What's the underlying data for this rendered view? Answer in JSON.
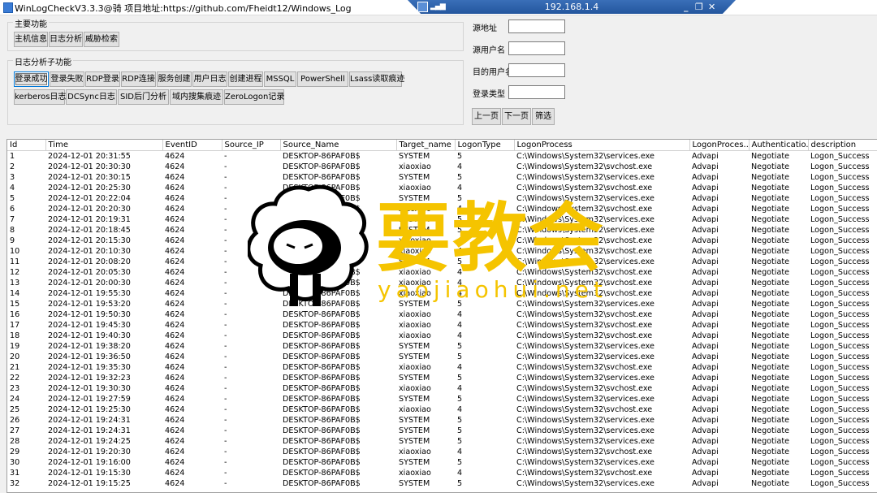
{
  "window": {
    "title": "WinLogCheckV3.3.3@骑 项目地址:https://github.com/Fheidt12/Windows_Log"
  },
  "rdp": {
    "ip": "192.168.1.4",
    "signal_icon": "signal-bars-icon",
    "pin_icon": "pin-icon",
    "minimize": "_",
    "restore": "❐",
    "close": "✕"
  },
  "main_functions": {
    "legend": "主要功能",
    "buttons": [
      "主机信息",
      "日志分析",
      "威胁检索"
    ]
  },
  "sub_functions": {
    "legend": "日志分析子功能",
    "row1": [
      "登录成功",
      "登录失败",
      "RDP登录",
      "RDP连接",
      "服务创建",
      "用户日志",
      "创建进程",
      "MSSQL",
      "PowerShell",
      "Lsass读取痕迹"
    ],
    "row2": [
      "kerberos日志",
      "DCSync日志",
      "SID后门分析",
      "域内搜集痕迹",
      "ZeroLogon记录"
    ]
  },
  "filters": {
    "source_addr_label": "源地址",
    "source_user_label": "源用户名",
    "target_user_label": "目的用户名",
    "logon_type_label": "登录类型",
    "source_addr_value": "",
    "source_user_value": "",
    "target_user_value": "",
    "logon_type_value": "",
    "prev_label": "上一页",
    "next_label": "下一页",
    "filter_label": "筛选"
  },
  "table": {
    "columns": [
      "Id",
      "Time",
      "EventID",
      "Source_IP",
      "Source_Name",
      "Target_name",
      "LogonType",
      "LogonProcess",
      "LogonProces...",
      "Authenticatio...",
      "description"
    ],
    "rows": [
      [
        "1",
        "2024-12-01 20:31:55",
        "4624",
        "-",
        "DESKTOP-86PAF0B$",
        "SYSTEM",
        "5",
        "C:\\Windows\\System32\\services.exe",
        "Advapi",
        "Negotiate",
        "Logon_Success"
      ],
      [
        "2",
        "2024-12-01 20:30:30",
        "4624",
        "-",
        "DESKTOP-86PAF0B$",
        "xiaoxiao",
        "4",
        "C:\\Windows\\System32\\svchost.exe",
        "Advapi",
        "Negotiate",
        "Logon_Success"
      ],
      [
        "3",
        "2024-12-01 20:30:15",
        "4624",
        "-",
        "DESKTOP-86PAF0B$",
        "SYSTEM",
        "5",
        "C:\\Windows\\System32\\services.exe",
        "Advapi",
        "Negotiate",
        "Logon_Success"
      ],
      [
        "4",
        "2024-12-01 20:25:30",
        "4624",
        "-",
        "DESKTOP-86PAF0B$",
        "xiaoxiao",
        "4",
        "C:\\Windows\\System32\\svchost.exe",
        "Advapi",
        "Negotiate",
        "Logon_Success"
      ],
      [
        "5",
        "2024-12-01 20:22:04",
        "4624",
        "-",
        "DESKTOP-86PAF0B$",
        "SYSTEM",
        "5",
        "C:\\Windows\\System32\\services.exe",
        "Advapi",
        "Negotiate",
        "Logon_Success"
      ],
      [
        "6",
        "2024-12-01 20:20:30",
        "4624",
        "-",
        "DESKTOP-86PAF0B$",
        "xiaoxiao",
        "4",
        "C:\\Windows\\System32\\svchost.exe",
        "Advapi",
        "Negotiate",
        "Logon_Success"
      ],
      [
        "7",
        "2024-12-01 20:19:31",
        "4624",
        "-",
        "DESKTOP-86PAF0B$",
        "SYSTEM",
        "5",
        "C:\\Windows\\System32\\services.exe",
        "Advapi",
        "Negotiate",
        "Logon_Success"
      ],
      [
        "8",
        "2024-12-01 20:18:45",
        "4624",
        "-",
        "DESKTOP-86PAF0B$",
        "SYSTEM",
        "5",
        "C:\\Windows\\System32\\services.exe",
        "Advapi",
        "Negotiate",
        "Logon_Success"
      ],
      [
        "9",
        "2024-12-01 20:15:30",
        "4624",
        "-",
        "DESKTOP-86PAF0B$",
        "xiaoxiao",
        "4",
        "C:\\Windows\\System32\\svchost.exe",
        "Advapi",
        "Negotiate",
        "Logon_Success"
      ],
      [
        "10",
        "2024-12-01 20:10:30",
        "4624",
        "-",
        "DESKTOP-86PAF0B$",
        "xiaoxiao",
        "4",
        "C:\\Windows\\System32\\svchost.exe",
        "Advapi",
        "Negotiate",
        "Logon_Success"
      ],
      [
        "11",
        "2024-12-01 20:08:20",
        "4624",
        "-",
        "DESKTOP-86PAF0B$",
        "SYSTEM",
        "5",
        "C:\\Windows\\System32\\services.exe",
        "Advapi",
        "Negotiate",
        "Logon_Success"
      ],
      [
        "12",
        "2024-12-01 20:05:30",
        "4624",
        "-",
        "DESKTOP-86PAF0B$",
        "xiaoxiao",
        "4",
        "C:\\Windows\\System32\\svchost.exe",
        "Advapi",
        "Negotiate",
        "Logon_Success"
      ],
      [
        "13",
        "2024-12-01 20:00:30",
        "4624",
        "-",
        "DESKTOP-86PAF0B$",
        "xiaoxiao",
        "4",
        "C:\\Windows\\System32\\svchost.exe",
        "Advapi",
        "Negotiate",
        "Logon_Success"
      ],
      [
        "14",
        "2024-12-01 19:55:30",
        "4624",
        "-",
        "DESKTOP-86PAF0B$",
        "xiaoxiao",
        "4",
        "C:\\Windows\\System32\\svchost.exe",
        "Advapi",
        "Negotiate",
        "Logon_Success"
      ],
      [
        "15",
        "2024-12-01 19:53:20",
        "4624",
        "-",
        "DESKTOP-86PAF0B$",
        "SYSTEM",
        "5",
        "C:\\Windows\\System32\\services.exe",
        "Advapi",
        "Negotiate",
        "Logon_Success"
      ],
      [
        "16",
        "2024-12-01 19:50:30",
        "4624",
        "-",
        "DESKTOP-86PAF0B$",
        "xiaoxiao",
        "4",
        "C:\\Windows\\System32\\svchost.exe",
        "Advapi",
        "Negotiate",
        "Logon_Success"
      ],
      [
        "17",
        "2024-12-01 19:45:30",
        "4624",
        "-",
        "DESKTOP-86PAF0B$",
        "xiaoxiao",
        "4",
        "C:\\Windows\\System32\\svchost.exe",
        "Advapi",
        "Negotiate",
        "Logon_Success"
      ],
      [
        "18",
        "2024-12-01 19:40:30",
        "4624",
        "-",
        "DESKTOP-86PAF0B$",
        "xiaoxiao",
        "4",
        "C:\\Windows\\System32\\svchost.exe",
        "Advapi",
        "Negotiate",
        "Logon_Success"
      ],
      [
        "19",
        "2024-12-01 19:38:20",
        "4624",
        "-",
        "DESKTOP-86PAF0B$",
        "SYSTEM",
        "5",
        "C:\\Windows\\System32\\services.exe",
        "Advapi",
        "Negotiate",
        "Logon_Success"
      ],
      [
        "20",
        "2024-12-01 19:36:50",
        "4624",
        "-",
        "DESKTOP-86PAF0B$",
        "SYSTEM",
        "5",
        "C:\\Windows\\System32\\services.exe",
        "Advapi",
        "Negotiate",
        "Logon_Success"
      ],
      [
        "21",
        "2024-12-01 19:35:30",
        "4624",
        "-",
        "DESKTOP-86PAF0B$",
        "xiaoxiao",
        "4",
        "C:\\Windows\\System32\\svchost.exe",
        "Advapi",
        "Negotiate",
        "Logon_Success"
      ],
      [
        "22",
        "2024-12-01 19:32:23",
        "4624",
        "-",
        "DESKTOP-86PAF0B$",
        "SYSTEM",
        "5",
        "C:\\Windows\\System32\\services.exe",
        "Advapi",
        "Negotiate",
        "Logon_Success"
      ],
      [
        "23",
        "2024-12-01 19:30:30",
        "4624",
        "-",
        "DESKTOP-86PAF0B$",
        "xiaoxiao",
        "4",
        "C:\\Windows\\System32\\svchost.exe",
        "Advapi",
        "Negotiate",
        "Logon_Success"
      ],
      [
        "24",
        "2024-12-01 19:27:59",
        "4624",
        "-",
        "DESKTOP-86PAF0B$",
        "SYSTEM",
        "5",
        "C:\\Windows\\System32\\services.exe",
        "Advapi",
        "Negotiate",
        "Logon_Success"
      ],
      [
        "25",
        "2024-12-01 19:25:30",
        "4624",
        "-",
        "DESKTOP-86PAF0B$",
        "xiaoxiao",
        "4",
        "C:\\Windows\\System32\\svchost.exe",
        "Advapi",
        "Negotiate",
        "Logon_Success"
      ],
      [
        "26",
        "2024-12-01 19:24:31",
        "4624",
        "-",
        "DESKTOP-86PAF0B$",
        "SYSTEM",
        "5",
        "C:\\Windows\\System32\\services.exe",
        "Advapi",
        "Negotiate",
        "Logon_Success"
      ],
      [
        "27",
        "2024-12-01 19:24:31",
        "4624",
        "-",
        "DESKTOP-86PAF0B$",
        "SYSTEM",
        "5",
        "C:\\Windows\\System32\\services.exe",
        "Advapi",
        "Negotiate",
        "Logon_Success"
      ],
      [
        "28",
        "2024-12-01 19:24:25",
        "4624",
        "-",
        "DESKTOP-86PAF0B$",
        "SYSTEM",
        "5",
        "C:\\Windows\\System32\\services.exe",
        "Advapi",
        "Negotiate",
        "Logon_Success"
      ],
      [
        "29",
        "2024-12-01 19:20:30",
        "4624",
        "-",
        "DESKTOP-86PAF0B$",
        "xiaoxiao",
        "4",
        "C:\\Windows\\System32\\svchost.exe",
        "Advapi",
        "Negotiate",
        "Logon_Success"
      ],
      [
        "30",
        "2024-12-01 19:16:00",
        "4624",
        "-",
        "DESKTOP-86PAF0B$",
        "SYSTEM",
        "5",
        "C:\\Windows\\System32\\services.exe",
        "Advapi",
        "Negotiate",
        "Logon_Success"
      ],
      [
        "31",
        "2024-12-01 19:15:30",
        "4624",
        "-",
        "DESKTOP-86PAF0B$",
        "xiaoxiao",
        "4",
        "C:\\Windows\\System32\\svchost.exe",
        "Advapi",
        "Negotiate",
        "Logon_Success"
      ],
      [
        "32",
        "2024-12-01 19:15:25",
        "4624",
        "-",
        "DESKTOP-86PAF0B$",
        "SYSTEM",
        "5",
        "C:\\Windows\\System32\\services.exe",
        "Advapi",
        "Negotiate",
        "Logon_Success"
      ]
    ]
  },
  "watermark": {
    "text": "要教会",
    "pinyin": "yaojiaohui.net",
    "logo_icon": "sheep-icon",
    "color": "#f5c400"
  }
}
